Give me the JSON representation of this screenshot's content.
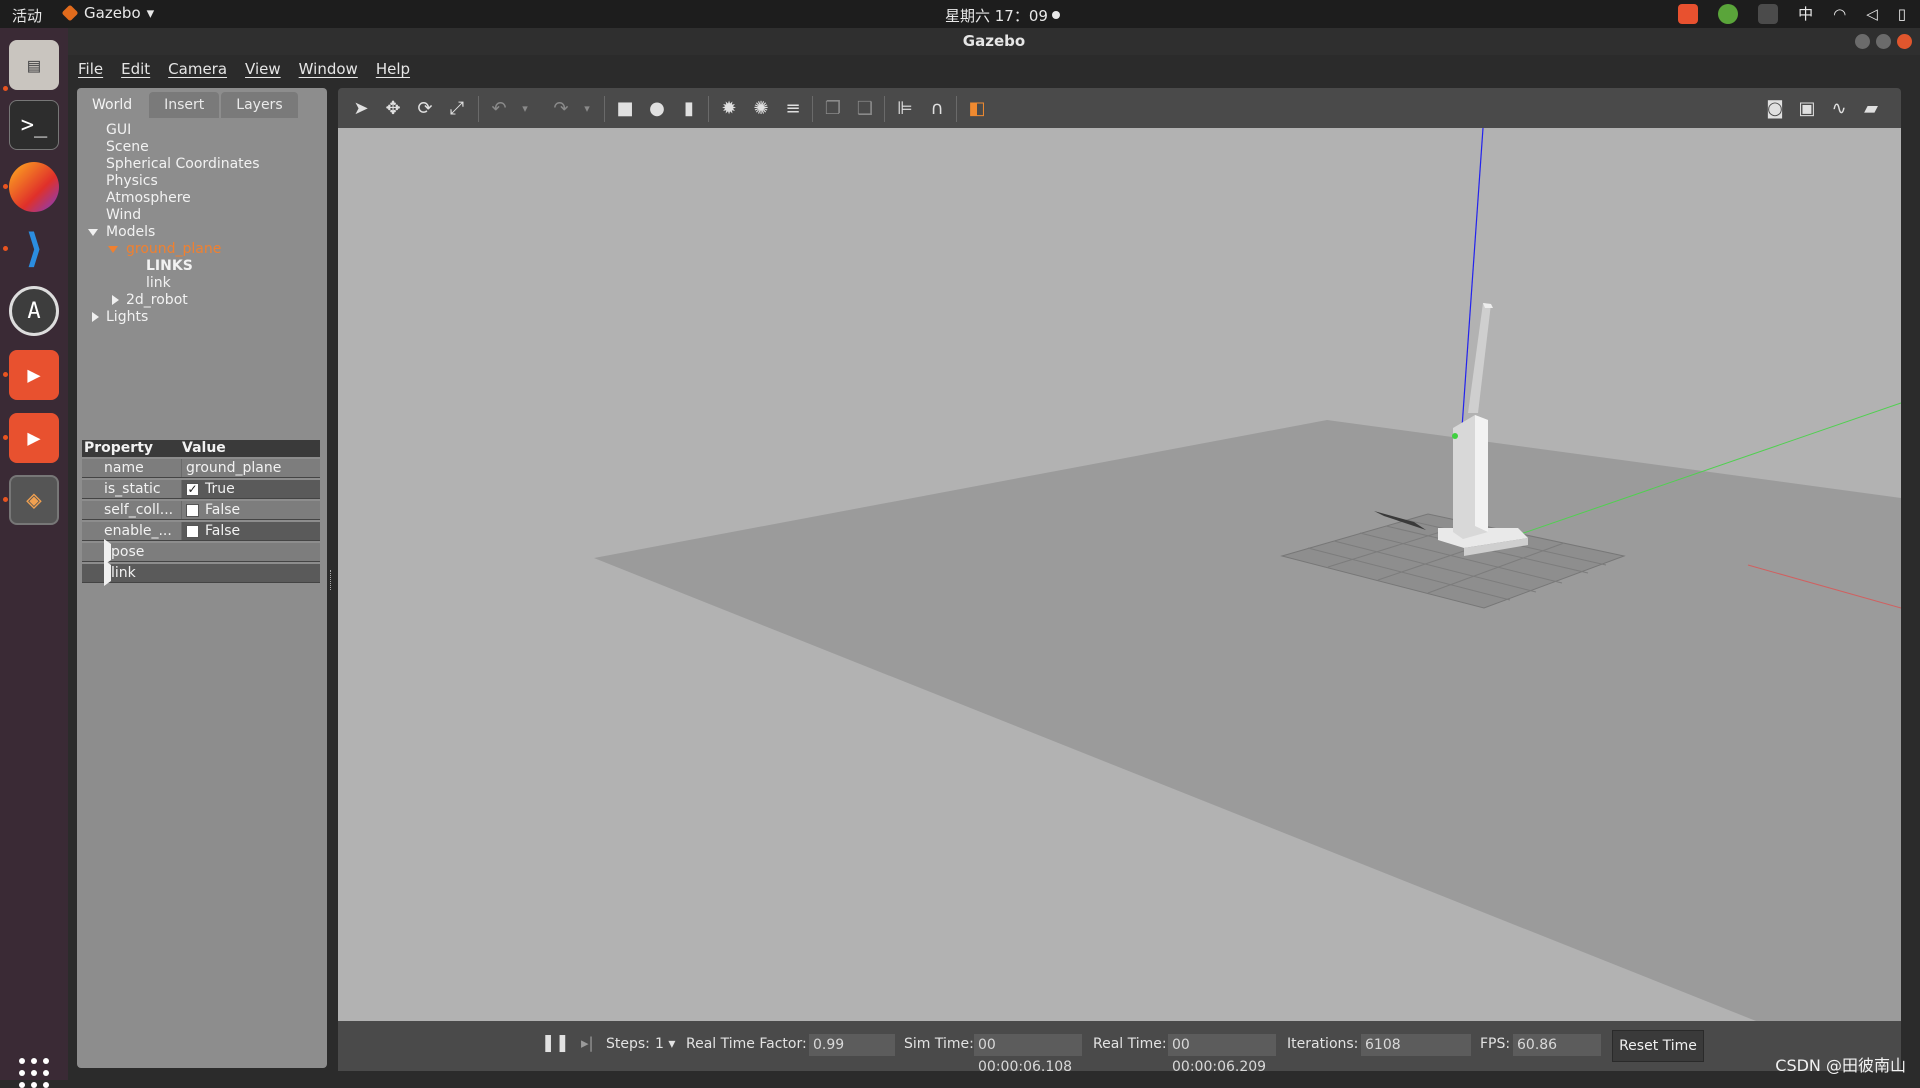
{
  "topbar": {
    "activities": "活动",
    "app_name": "Gazebo",
    "clock": "星期六 17：09",
    "input_method": "中"
  },
  "window": {
    "title": "Gazebo"
  },
  "menu": {
    "items": [
      {
        "label": "File"
      },
      {
        "label": "Edit"
      },
      {
        "label": "Camera"
      },
      {
        "label": "View"
      },
      {
        "label": "Window"
      },
      {
        "label": "Help"
      }
    ]
  },
  "left_tabs": {
    "world": "World",
    "insert": "Insert",
    "layers": "Layers"
  },
  "tree": {
    "gui": "GUI",
    "scene": "Scene",
    "spherical": "Spherical Coordinates",
    "physics": "Physics",
    "atmosphere": "Atmosphere",
    "wind": "Wind",
    "models": "Models",
    "ground_plane": "ground_plane",
    "links_header": "LINKS",
    "link": "link",
    "robot": "2d_robot",
    "lights": "Lights"
  },
  "properties": {
    "header_property": "Property",
    "header_value": "Value",
    "rows": {
      "name": {
        "key": "name",
        "value": "ground_plane"
      },
      "is_static": {
        "key": "is_static",
        "value": "True",
        "checked": true
      },
      "self_coll": {
        "key": "self_coll...",
        "value": "False",
        "checked": false
      },
      "enable": {
        "key": "enable_...",
        "value": "False",
        "checked": false
      }
    },
    "pose": "pose",
    "link": "link"
  },
  "bottombar": {
    "steps_label": "Steps:",
    "steps_value": "1",
    "rtf_label": "Real Time Factor:",
    "rtf_value": "0.99",
    "sim_time_label": "Sim Time:",
    "sim_time_value": "00 00:00:06.108",
    "real_time_label": "Real Time:",
    "real_time_value": "00 00:00:06.209",
    "iterations_label": "Iterations:",
    "iterations_value": "6108",
    "fps_label": "FPS:",
    "fps_value": "60.86",
    "reset_label": "Reset Time"
  },
  "watermark": "CSDN @田彼南山",
  "icons": {
    "select": "arrow-select-icon",
    "translate": "move-icon",
    "rotate": "rotate-icon",
    "scale": "scale-icon",
    "undo": "undo-icon",
    "redo": "redo-icon",
    "box": "box-shape-icon",
    "sphere": "sphere-shape-icon",
    "cylinder": "cylinder-shape-icon",
    "point_light": "point-light-icon",
    "spot_light": "spot-light-icon",
    "dir_light": "directional-light-icon",
    "copy": "copy-icon",
    "paste": "paste-icon",
    "align": "align-icon",
    "snap": "snap-icon",
    "view_angle": "view-angle-icon",
    "screenshot": "camera-screenshot-icon",
    "log": "log-icon",
    "plot": "plot-icon",
    "record": "video-record-icon"
  },
  "colors": {
    "selected_tree": "#f08030",
    "viewport_bg": "#b2b2b2",
    "ground": "#9a9a9a",
    "axis_x": "#e05050",
    "axis_y": "#40c040",
    "axis_z": "#3030e0"
  }
}
